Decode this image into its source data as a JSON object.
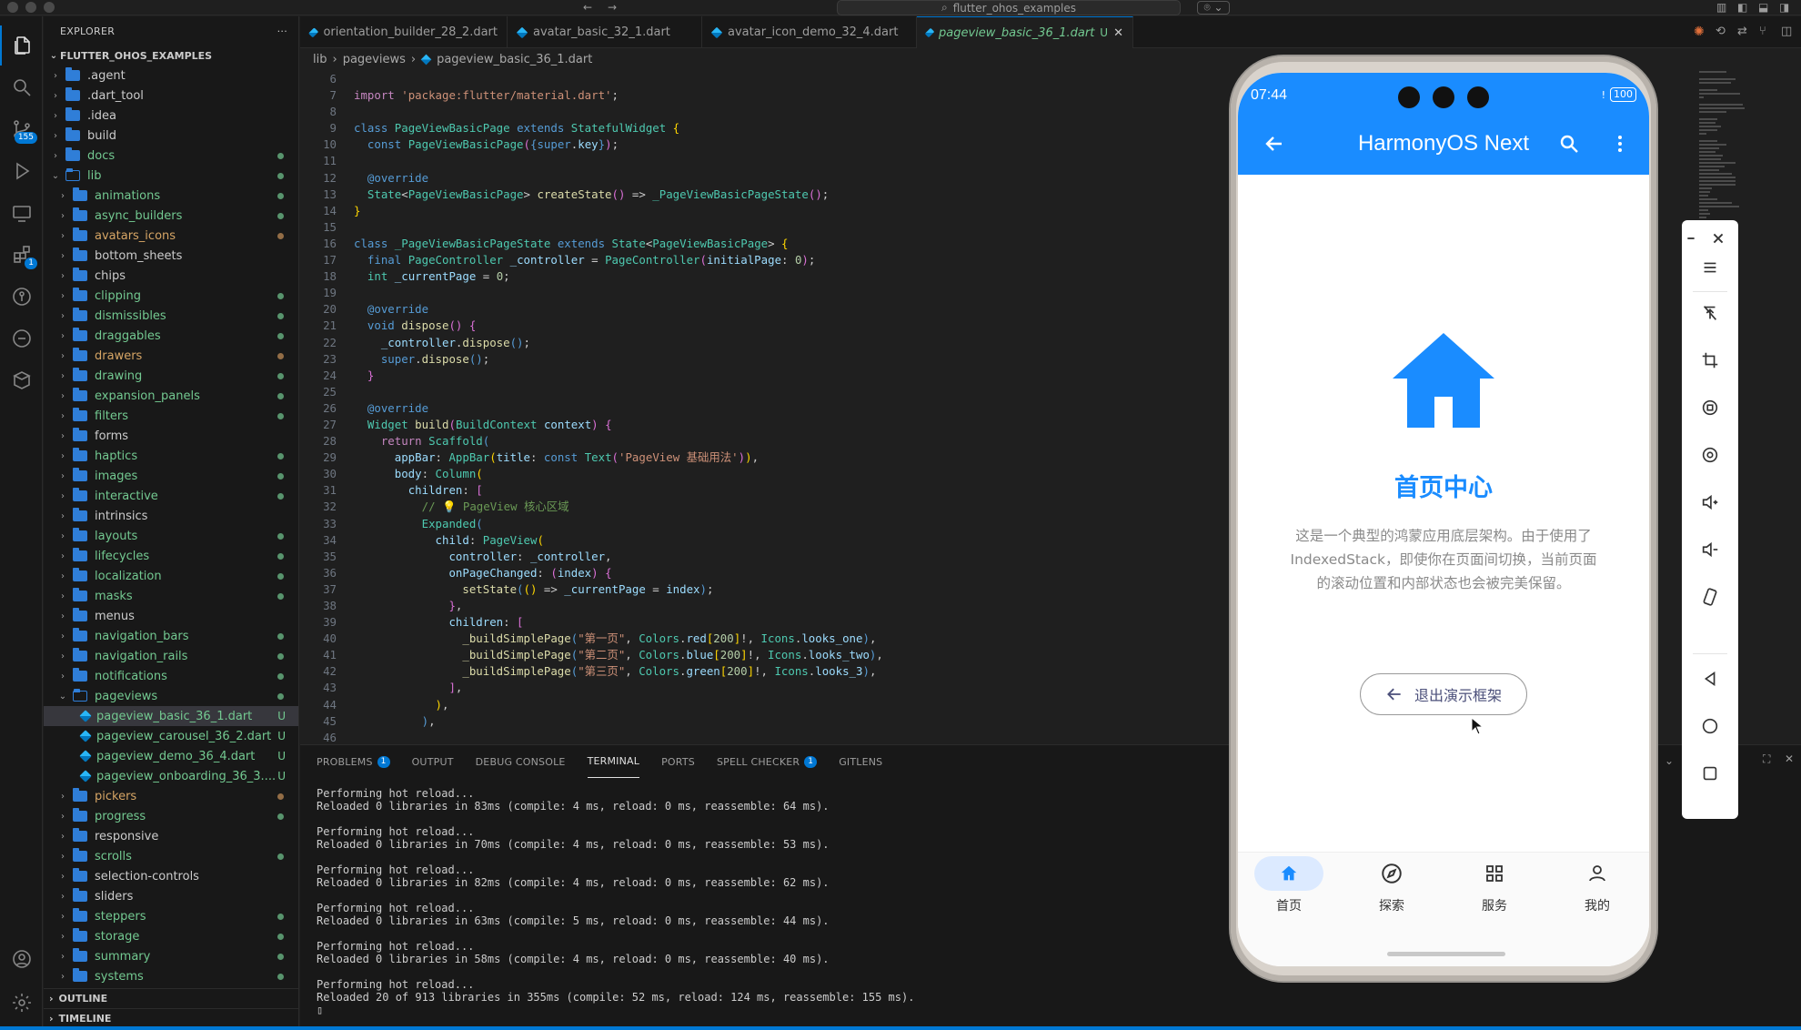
{
  "window": {
    "search": "flutter_ohos_examples"
  },
  "activity_bar": {
    "scm_badge": "155",
    "extensions_badge": "1"
  },
  "sidebar": {
    "title": "EXPLORER",
    "more": "···",
    "project": "FLUTTER_OHOS_EXAMPLES",
    "items": [
      {
        "label": ".agent",
        "indent": 1,
        "type": "folder",
        "color": "white"
      },
      {
        "label": ".dart_tool",
        "indent": 1,
        "type": "folder",
        "color": "white"
      },
      {
        "label": ".idea",
        "indent": 1,
        "type": "folder",
        "color": "white"
      },
      {
        "label": "build",
        "indent": 1,
        "type": "folder",
        "color": "white"
      },
      {
        "label": "docs",
        "indent": 1,
        "type": "folder",
        "color": "green",
        "dot": "green"
      },
      {
        "label": "lib",
        "indent": 1,
        "type": "folder-open",
        "color": "green",
        "dot": "green"
      },
      {
        "label": "animations",
        "indent": 2,
        "type": "folder",
        "color": "green",
        "dot": "green"
      },
      {
        "label": "async_builders",
        "indent": 2,
        "type": "folder",
        "color": "green",
        "dot": "green"
      },
      {
        "label": "avatars_icons",
        "indent": 2,
        "type": "folder",
        "color": "orange",
        "dot": "orange"
      },
      {
        "label": "bottom_sheets",
        "indent": 2,
        "type": "folder",
        "color": "white"
      },
      {
        "label": "chips",
        "indent": 2,
        "type": "folder",
        "color": "white"
      },
      {
        "label": "clipping",
        "indent": 2,
        "type": "folder",
        "color": "green",
        "dot": "green"
      },
      {
        "label": "dismissibles",
        "indent": 2,
        "type": "folder",
        "color": "green",
        "dot": "green"
      },
      {
        "label": "draggables",
        "indent": 2,
        "type": "folder",
        "color": "green",
        "dot": "green"
      },
      {
        "label": "drawers",
        "indent": 2,
        "type": "folder",
        "color": "orange",
        "dot": "orange"
      },
      {
        "label": "drawing",
        "indent": 2,
        "type": "folder",
        "color": "green",
        "dot": "green"
      },
      {
        "label": "expansion_panels",
        "indent": 2,
        "type": "folder",
        "color": "green",
        "dot": "green"
      },
      {
        "label": "filters",
        "indent": 2,
        "type": "folder",
        "color": "green",
        "dot": "green"
      },
      {
        "label": "forms",
        "indent": 2,
        "type": "folder",
        "color": "white"
      },
      {
        "label": "haptics",
        "indent": 2,
        "type": "folder",
        "color": "green",
        "dot": "green"
      },
      {
        "label": "images",
        "indent": 2,
        "type": "folder",
        "color": "green",
        "dot": "green"
      },
      {
        "label": "interactive",
        "indent": 2,
        "type": "folder",
        "color": "green",
        "dot": "green"
      },
      {
        "label": "intrinsics",
        "indent": 2,
        "type": "folder",
        "color": "white"
      },
      {
        "label": "layouts",
        "indent": 2,
        "type": "folder",
        "color": "green",
        "dot": "green"
      },
      {
        "label": "lifecycles",
        "indent": 2,
        "type": "folder",
        "color": "green",
        "dot": "green"
      },
      {
        "label": "localization",
        "indent": 2,
        "type": "folder",
        "color": "green",
        "dot": "green"
      },
      {
        "label": "masks",
        "indent": 2,
        "type": "folder",
        "color": "green",
        "dot": "green"
      },
      {
        "label": "menus",
        "indent": 2,
        "type": "folder",
        "color": "white"
      },
      {
        "label": "navigation_bars",
        "indent": 2,
        "type": "folder",
        "color": "green",
        "dot": "green"
      },
      {
        "label": "navigation_rails",
        "indent": 2,
        "type": "folder",
        "color": "green",
        "dot": "green"
      },
      {
        "label": "notifications",
        "indent": 2,
        "type": "folder",
        "color": "green",
        "dot": "green"
      },
      {
        "label": "pageviews",
        "indent": 2,
        "type": "folder-open",
        "color": "green",
        "dot": "green"
      },
      {
        "label": "pageview_basic_36_1.dart",
        "indent": 3,
        "type": "dart",
        "color": "green",
        "u": "U",
        "selected": true
      },
      {
        "label": "pageview_carousel_36_2.dart",
        "indent": 3,
        "type": "dart",
        "color": "green",
        "u": "U"
      },
      {
        "label": "pageview_demo_36_4.dart",
        "indent": 3,
        "type": "dart",
        "color": "green",
        "u": "U"
      },
      {
        "label": "pageview_onboarding_36_3....",
        "indent": 3,
        "type": "dart",
        "color": "green",
        "u": "U"
      },
      {
        "label": "pickers",
        "indent": 2,
        "type": "folder",
        "color": "orange",
        "dot": "orange"
      },
      {
        "label": "progress",
        "indent": 2,
        "type": "folder",
        "color": "green",
        "dot": "green"
      },
      {
        "label": "responsive",
        "indent": 2,
        "type": "folder",
        "color": "white"
      },
      {
        "label": "scrolls",
        "indent": 2,
        "type": "folder",
        "color": "green",
        "dot": "green"
      },
      {
        "label": "selection-controls",
        "indent": 2,
        "type": "folder",
        "color": "white"
      },
      {
        "label": "sliders",
        "indent": 2,
        "type": "folder",
        "color": "white"
      },
      {
        "label": "steppers",
        "indent": 2,
        "type": "folder",
        "color": "green",
        "dot": "green"
      },
      {
        "label": "storage",
        "indent": 2,
        "type": "folder",
        "color": "green",
        "dot": "green"
      },
      {
        "label": "summary",
        "indent": 2,
        "type": "folder",
        "color": "green",
        "dot": "green"
      },
      {
        "label": "systems",
        "indent": 2,
        "type": "folder",
        "color": "green",
        "dot": "green"
      }
    ],
    "outline": "OUTLINE",
    "timeline": "TIMELINE"
  },
  "tabs": [
    {
      "label": "orientation_builder_28_2.dart",
      "close": ""
    },
    {
      "label": "avatar_basic_32_1.dart",
      "close": ""
    },
    {
      "label": "avatar_icon_demo_32_4.dart",
      "close": ""
    },
    {
      "label": "pageview_basic_36_1.dart",
      "status": "U",
      "close": "✕",
      "active": true
    }
  ],
  "breadcrumb": [
    "lib",
    "pageviews",
    "pageview_basic_36_1.dart"
  ],
  "code_lines": [
    {
      "n": "6",
      "html": ""
    },
    {
      "n": "7",
      "html": "<span class='kp'>import</span> <span class='s'>'package:flutter/material.dart'</span>;"
    },
    {
      "n": "8",
      "html": ""
    },
    {
      "n": "9",
      "html": "<span class='k'>class</span> <span class='t'>PageViewBasicPage</span> <span class='k'>extends</span> <span class='t'>StatefulWidget</span> <span class='y'>{</span>"
    },
    {
      "n": "10",
      "html": "  <span class='k'>const</span> <span class='t'>PageViewBasicPage</span><span class='pk'>(</span><span class='k'>{</span><span class='k'>super</span>.<span class='v'>key</span><span class='k'>}</span><span class='pk'>)</span>;"
    },
    {
      "n": "11",
      "html": ""
    },
    {
      "n": "12",
      "html": "  <span class='an'>@override</span>"
    },
    {
      "n": "13",
      "html": "  <span class='t'>State</span>&lt;<span class='t'>PageViewBasicPage</span>&gt; <span class='f'>createState</span><span class='pk'>()</span> =&gt; <span class='t'>_PageViewBasicPageState</span><span class='pk'>()</span>;"
    },
    {
      "n": "14",
      "html": "<span class='y'>}</span>"
    },
    {
      "n": "15",
      "html": ""
    },
    {
      "n": "16",
      "html": "<span class='k'>class</span> <span class='t'>_PageViewBasicPageState</span> <span class='k'>extends</span> <span class='t'>State</span>&lt;<span class='t'>PageViewBasicPage</span>&gt; <span class='y'>{</span>"
    },
    {
      "n": "17",
      "html": "  <span class='k'>final</span> <span class='t'>PageController</span> <span class='v'>_controller</span> = <span class='t'>PageController</span><span class='pk'>(</span><span class='v'>initialPage</span>: <span class='n'>0</span><span class='pk'>)</span>;"
    },
    {
      "n": "18",
      "html": "  <span class='t'>int</span> <span class='v'>_currentPage</span> = <span class='n'>0</span>;"
    },
    {
      "n": "19",
      "html": ""
    },
    {
      "n": "20",
      "html": "  <span class='an'>@override</span>"
    },
    {
      "n": "21",
      "html": "  <span class='k'>void</span> <span class='f'>dispose</span><span class='pk'>()</span> <span class='pk'>{</span>"
    },
    {
      "n": "22",
      "html": "    <span class='v'>_controller</span>.<span class='f'>dispose</span><span class='k'>()</span>;"
    },
    {
      "n": "23",
      "html": "    <span class='k'>super</span>.<span class='f'>dispose</span><span class='k'>()</span>;"
    },
    {
      "n": "24",
      "html": "  <span class='pk'>}</span>"
    },
    {
      "n": "25",
      "html": ""
    },
    {
      "n": "26",
      "html": "  <span class='an'>@override</span>"
    },
    {
      "n": "27",
      "html": "  <span class='t'>Widget</span> <span class='f'>build</span><span class='pk'>(</span><span class='t'>BuildContext</span> <span class='v'>context</span><span class='pk'>)</span> <span class='pk'>{</span>"
    },
    {
      "n": "28",
      "html": "    <span class='kp'>return</span> <span class='t'>Scaffold</span><span class='k'>(</span>"
    },
    {
      "n": "29",
      "html": "      <span class='v'>appBar</span>: <span class='t'>AppBar</span><span class='y'>(</span><span class='v'>title</span>: <span class='k'>const</span> <span class='t'>Text</span><span class='pk'>(</span><span class='s'>'PageView 基础用法'</span><span class='pk'>)</span><span class='y'>)</span>,"
    },
    {
      "n": "30",
      "html": "      <span class='v'>body</span>: <span class='t'>Column</span><span class='y'>(</span>"
    },
    {
      "n": "31",
      "html": "        <span class='v'>children</span>: <span class='pk'>[</span>"
    },
    {
      "n": "32",
      "html": "          <span class='cm'>// 💡 PageView 核心区域</span>"
    },
    {
      "n": "33",
      "html": "          <span class='t'>Expanded</span><span class='k'>(</span>"
    },
    {
      "n": "34",
      "html": "            <span class='v'>child</span>: <span class='t'>PageView</span><span class='y'>(</span>"
    },
    {
      "n": "35",
      "html": "              <span class='v'>controller</span>: <span class='v'>_controller</span>,"
    },
    {
      "n": "36",
      "html": "              <span class='v'>onPageChanged</span>: <span class='pk'>(</span><span class='v'>index</span><span class='pk'>)</span> <span class='pk'>{</span>"
    },
    {
      "n": "37",
      "html": "                <span class='f'>setState</span><span class='k'>(</span><span class='y'>()</span> =&gt; <span class='v'>_currentPage</span> = <span class='v'>index</span><span class='k'>)</span>;"
    },
    {
      "n": "38",
      "html": "              <span class='pk'>}</span>,"
    },
    {
      "n": "39",
      "html": "              <span class='v'>children</span>: <span class='pk'>[</span>"
    },
    {
      "n": "40",
      "html": "                <span class='f'>_buildSimplePage</span><span class='k'>(</span><span class='s'>\"第一页\"</span>, <span class='t'>Colors</span>.<span class='v'>red</span><span class='y'>[</span><span class='n'>200</span><span class='y'>]</span>!, <span class='t'>Icons</span>.<span class='v'>looks_one</span><span class='k'>)</span>,"
    },
    {
      "n": "41",
      "html": "                <span class='f'>_buildSimplePage</span><span class='k'>(</span><span class='s'>\"第二页\"</span>, <span class='t'>Colors</span>.<span class='v'>blue</span><span class='y'>[</span><span class='n'>200</span><span class='y'>]</span>!, <span class='t'>Icons</span>.<span class='v'>looks_two</span><span class='k'>)</span>,"
    },
    {
      "n": "42",
      "html": "                <span class='f'>_buildSimplePage</span><span class='k'>(</span><span class='s'>\"第三页\"</span>, <span class='t'>Colors</span>.<span class='v'>green</span><span class='y'>[</span><span class='n'>200</span><span class='y'>]</span>!, <span class='t'>Icons</span>.<span class='v'>looks_3</span><span class='k'>)</span>,"
    },
    {
      "n": "43",
      "html": "              <span class='pk'>]</span>,"
    },
    {
      "n": "44",
      "html": "            <span class='y'>)</span>,"
    },
    {
      "n": "45",
      "html": "          <span class='k'>)</span>,"
    },
    {
      "n": "46",
      "html": ""
    }
  ],
  "panel": {
    "tabs": [
      {
        "label": "PROBLEMS",
        "badge": "1"
      },
      {
        "label": "OUTPUT"
      },
      {
        "label": "DEBUG CONSOLE"
      },
      {
        "label": "TERMINAL",
        "active": true
      },
      {
        "label": "PORTS"
      },
      {
        "label": "SPELL CHECKER",
        "badge": "1"
      },
      {
        "label": "GITLENS"
      }
    ],
    "terminal": [
      "Performing hot reload...",
      "Reloaded 0 libraries in 83ms (compile: 4 ms, reload: 0 ms, reassemble: 64 ms).",
      "",
      "Performing hot reload...",
      "Reloaded 0 libraries in 70ms (compile: 4 ms, reload: 0 ms, reassemble: 53 ms).",
      "",
      "Performing hot reload...",
      "Reloaded 0 libraries in 82ms (compile: 4 ms, reload: 0 ms, reassemble: 62 ms).",
      "",
      "Performing hot reload...",
      "Reloaded 0 libraries in 63ms (compile: 5 ms, reload: 0 ms, reassemble: 44 ms).",
      "",
      "Performing hot reload...",
      "Reloaded 0 libraries in 58ms (compile: 4 ms, reload: 0 ms, reassemble: 40 ms).",
      "",
      "Performing hot reload...",
      "Reloaded 20 of 913 libraries in 355ms (compile: 52 ms, reload: 124 ms, reassemble: 155 ms).",
      "▯"
    ]
  },
  "phone": {
    "time": "07:44",
    "battery": "100",
    "battery_flag": "!",
    "appbar_title": "HarmonyOS Next",
    "heading": "首页中心",
    "description": "这是一个典型的鸿蒙应用底层架构。由于使用了 IndexedStack，即使你在页面间切换，当前页面的滚动位置和内部状态也会被完美保留。",
    "exit_button": "退出演示框架",
    "nav": [
      {
        "label": "首页",
        "icon": "home-icon",
        "active": true
      },
      {
        "label": "探索",
        "icon": "compass-icon"
      },
      {
        "label": "服务",
        "icon": "grid-icon"
      },
      {
        "label": "我的",
        "icon": "person-icon"
      }
    ],
    "accent": "#1a8cff"
  }
}
